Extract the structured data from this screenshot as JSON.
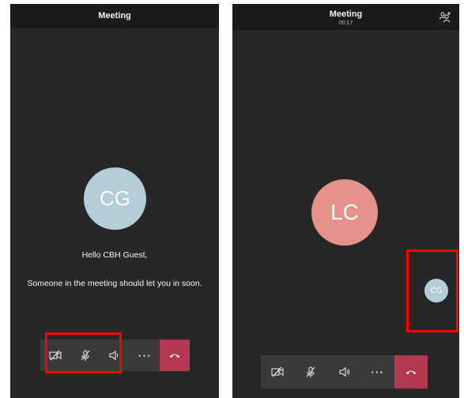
{
  "left_screen": {
    "title": "Meeting",
    "avatar_initials": "CG",
    "greeting": "Hello CBH Guest,",
    "waiting_message": "Someone in the meeting should let you in soon.",
    "controls": {
      "camera_icon": "camera-off-icon",
      "mic_icon": "mic-off-icon",
      "speaker_icon": "speaker-icon",
      "more_label": "···",
      "hangup_icon": "hang-up-icon"
    }
  },
  "right_screen": {
    "title": "Meeting",
    "timer": "00:17",
    "participants_icon": "participants-add-icon",
    "main_avatar_initials": "LC",
    "self_view_initials": "CG",
    "controls": {
      "camera_icon": "camera-off-icon",
      "mic_icon": "mic-off-icon",
      "speaker_icon": "speaker-on-icon",
      "more_label": "···",
      "hangup_icon": "hang-up-icon"
    }
  },
  "colors": {
    "background": "#272727",
    "topbar": "#1b1b1b",
    "control_bar": "#3a3a3a",
    "hangup": "#b4384f",
    "avatar_cg": "#b4cdd6",
    "avatar_lc": "#e4928a",
    "highlight": "#ff0000"
  }
}
